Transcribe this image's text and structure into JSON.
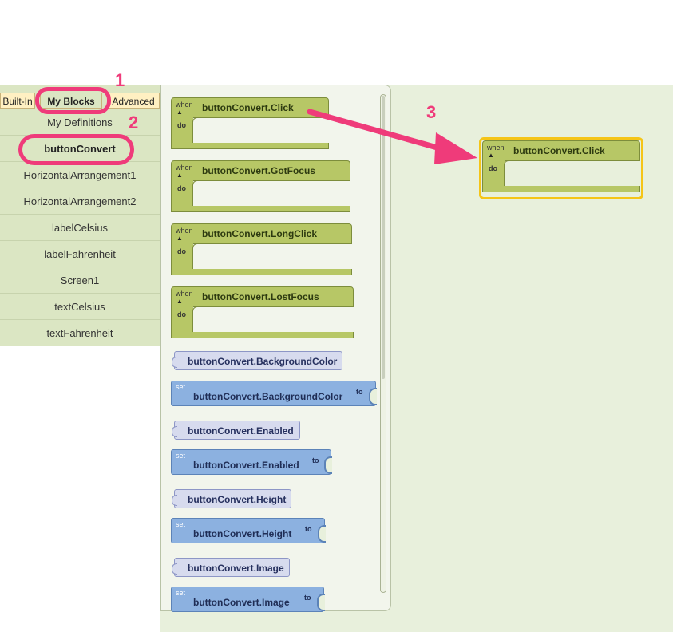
{
  "tabs": {
    "built_in": "Built-In",
    "my_blocks": "My Blocks",
    "advanced": "Advanced"
  },
  "sidebar": {
    "items": [
      "My Definitions",
      "buttonConvert",
      "HorizontalArrangement1",
      "HorizontalArrangement2",
      "labelCelsius",
      "labelFahrenheit",
      "Screen1",
      "textCelsius",
      "textFahrenheit"
    ]
  },
  "flyout": {
    "events": [
      {
        "when": "when",
        "do": "do",
        "name": "buttonConvert.Click"
      },
      {
        "when": "when",
        "do": "do",
        "name": "buttonConvert.GotFocus"
      },
      {
        "when": "when",
        "do": "do",
        "name": "buttonConvert.LongClick"
      },
      {
        "when": "when",
        "do": "do",
        "name": "buttonConvert.LostFocus"
      }
    ],
    "getters": [
      "buttonConvert.BackgroundColor",
      "buttonConvert.Enabled",
      "buttonConvert.Height",
      "buttonConvert.Image"
    ],
    "setters": [
      {
        "set": "set",
        "name": "buttonConvert.BackgroundColor",
        "to": "to"
      },
      {
        "set": "set",
        "name": "buttonConvert.Enabled",
        "to": "to"
      },
      {
        "set": "set",
        "name": "buttonConvert.Height",
        "to": "to"
      },
      {
        "set": "set",
        "name": "buttonConvert.Image",
        "to": "to"
      }
    ]
  },
  "workspace": {
    "block": {
      "when": "when",
      "do": "do",
      "name": "buttonConvert.Click"
    }
  },
  "annotations": {
    "step1": "1",
    "step2": "2",
    "step3": "3"
  },
  "colors": {
    "highlight": "#ef3b7a",
    "event_block": "#b7c766",
    "setter_block": "#8cb1e0",
    "getter_block": "#d7dbee",
    "selection_halo": "#f5c518"
  }
}
